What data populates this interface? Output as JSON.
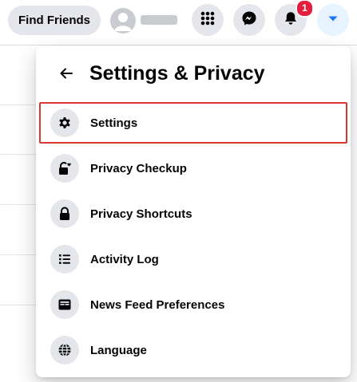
{
  "topbar": {
    "find_friends_label": "Find Friends",
    "notification_count": "1",
    "icons": [
      "menu-grid-icon",
      "messenger-icon",
      "bell-icon",
      "caret-down-icon"
    ],
    "accent_color": "#1877f2",
    "badge_color": "#e41e3f"
  },
  "dropdown": {
    "title": "Settings & Privacy",
    "back_icon": "arrow-left-icon",
    "items": [
      {
        "label": "Settings",
        "icon": "gear-icon",
        "highlighted": true
      },
      {
        "label": "Privacy Checkup",
        "icon": "lock-heart-icon"
      },
      {
        "label": "Privacy Shortcuts",
        "icon": "lock-icon"
      },
      {
        "label": "Activity Log",
        "icon": "list-icon"
      },
      {
        "label": "News Feed Preferences",
        "icon": "feed-icon"
      },
      {
        "label": "Language",
        "icon": "globe-icon"
      }
    ],
    "highlight_color": "#d93832"
  }
}
